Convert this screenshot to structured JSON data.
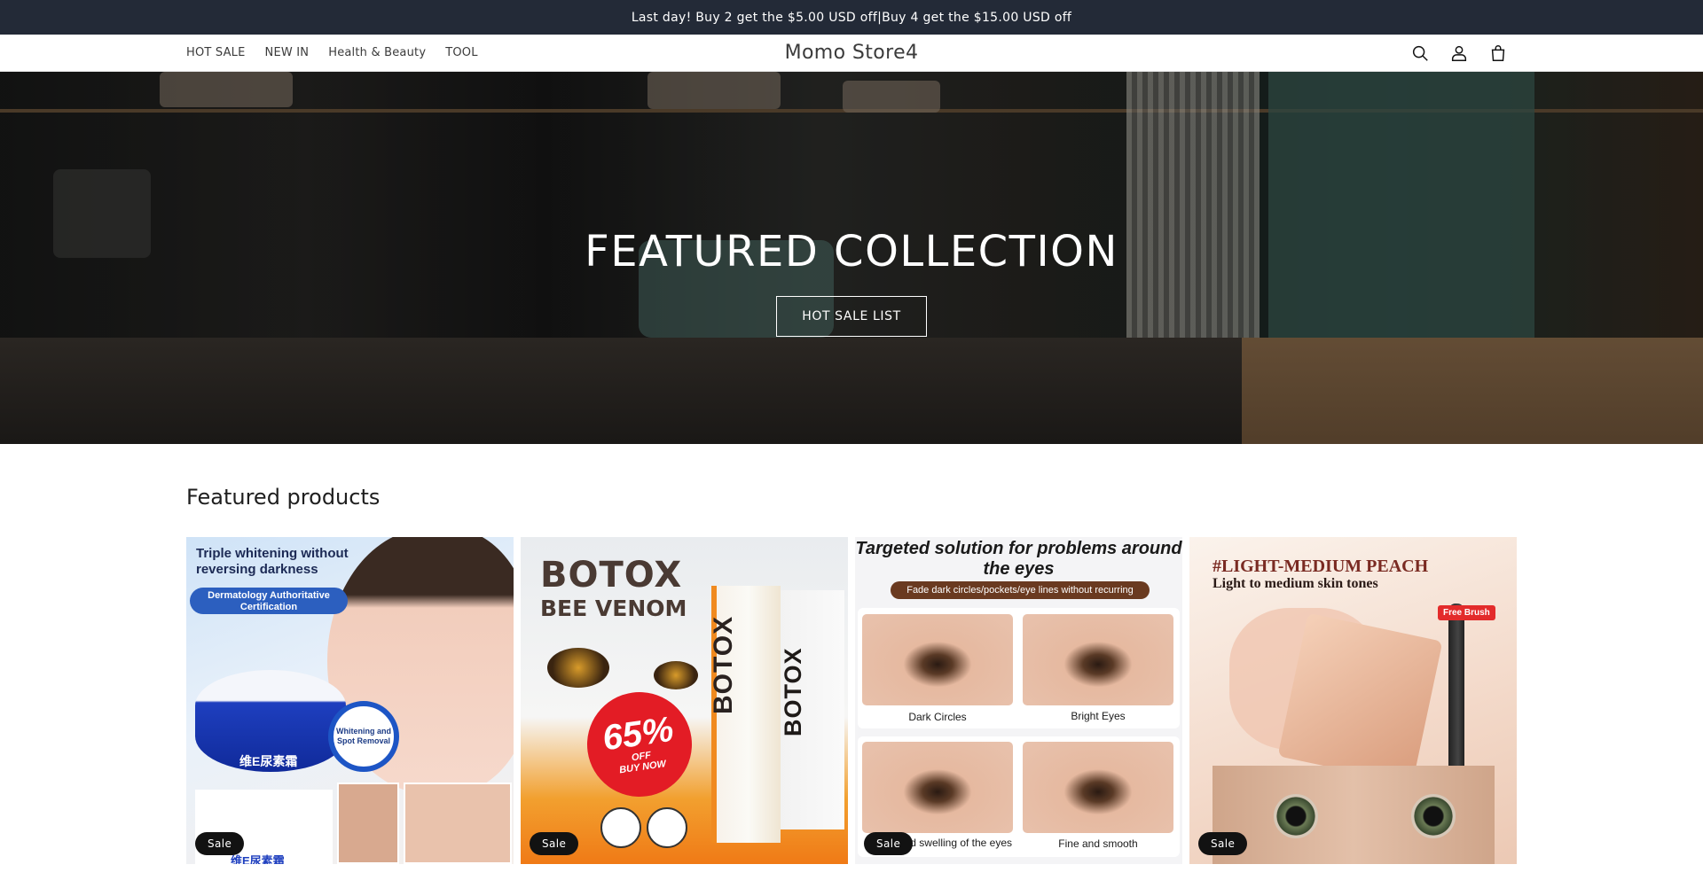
{
  "announcement": {
    "text": "Last day!   Buy 2 get the  $5.00 USD off|Buy 4 get the  $15.00 USD off"
  },
  "header": {
    "nav": [
      "HOT SALE",
      "NEW IN",
      "Health & Beauty",
      "TOOL"
    ],
    "logo": "Momo Store4",
    "icons": [
      "search-icon",
      "account-icon",
      "cart-icon"
    ]
  },
  "hero": {
    "title": "FEATURED COLLECTION",
    "button_label": "HOT SALE LIST"
  },
  "featured": {
    "title": "Featured products",
    "sale_label": "Sale",
    "products": [
      {
        "headline": "Triple whitening without reversing darkness",
        "pill": "Dermatology Authoritative Certification",
        "badge": "Whitening and Spot Removal",
        "jar_text": "维E尿素霜",
        "box_text": "维E尿素霜"
      },
      {
        "brand_line1": "BOTOX",
        "brand_line2": "BEE VENOM",
        "discount": "65%",
        "discount_off": "OFF",
        "buy_now": "BUY NOW",
        "tube_text": "BOTOX",
        "box_text": "BOTOX"
      },
      {
        "headline": "Targeted solution for problems around the eyes",
        "pill": "Fade dark circles/pockets/eye lines without recurring",
        "labels": [
          "Dark Circles",
          "Bright Eyes",
          "and swelling of the eyes",
          "Fine and smooth"
        ]
      },
      {
        "headline": "#LIGHT-MEDIUM PEACH",
        "subline": "Light to medium skin tones",
        "free_tag": "Free Brush"
      }
    ]
  },
  "colors": {
    "announcement_bg": "#232a37",
    "sale_badge_bg": "#121212",
    "text_primary": "#121212"
  }
}
